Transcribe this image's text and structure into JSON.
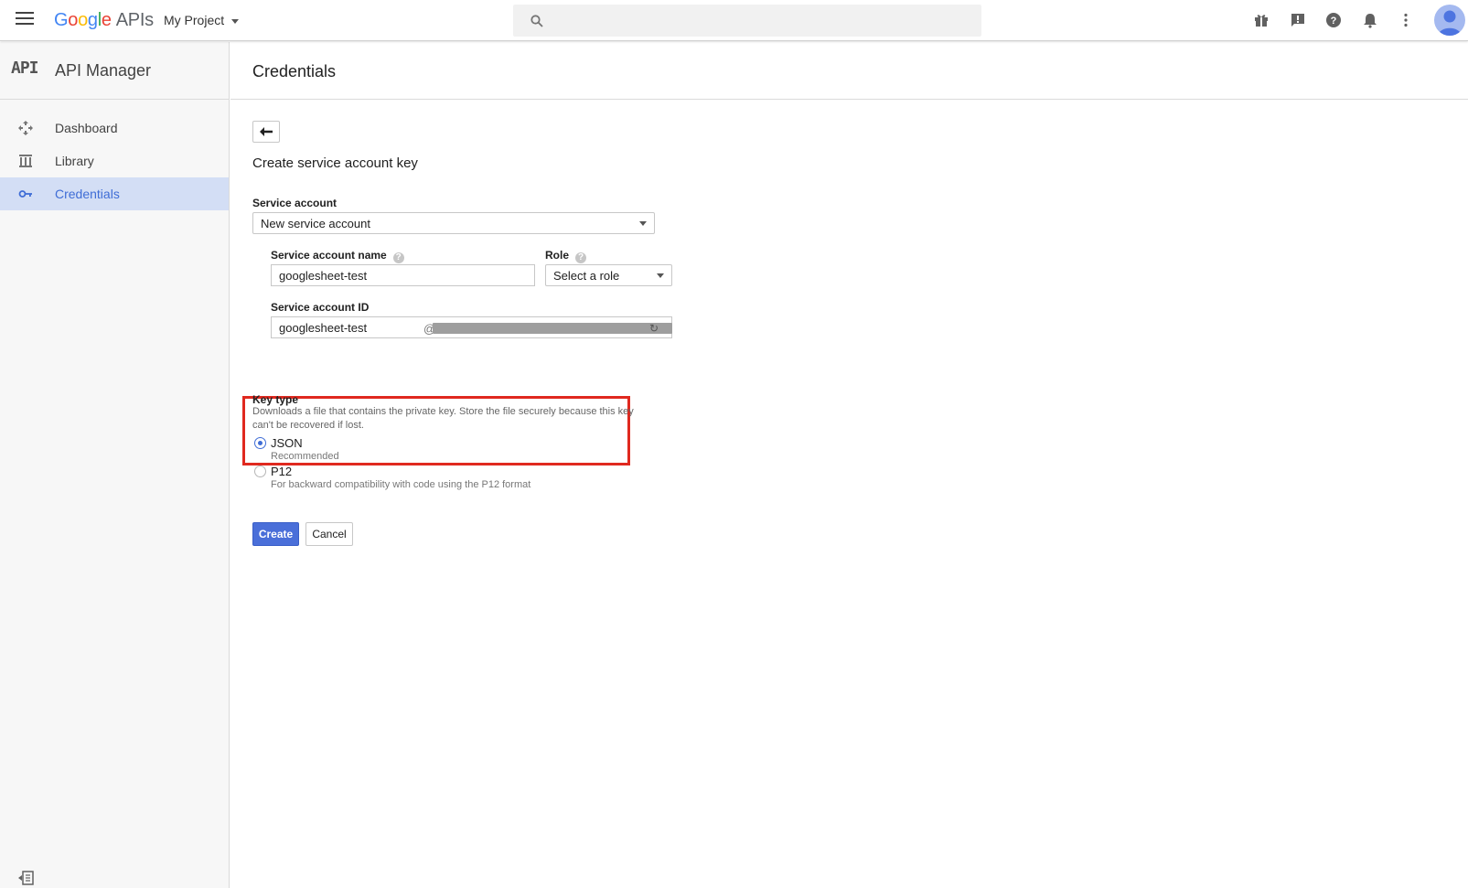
{
  "topbar": {
    "logo_letters": [
      "G",
      "o",
      "o",
      "g",
      "l",
      "e"
    ],
    "logo_suffix": "APIs",
    "project": "My Project",
    "search_placeholder": "",
    "icons": [
      "gift-icon",
      "feedback-icon",
      "help-icon",
      "notifications-icon",
      "more-vert-icon",
      "account-avatar"
    ]
  },
  "sidebar": {
    "mark": "API",
    "title": "API Manager",
    "items": [
      {
        "label": "Dashboard",
        "icon": "dashboard-icon",
        "active": false
      },
      {
        "label": "Library",
        "icon": "library-icon",
        "active": false
      },
      {
        "label": "Credentials",
        "icon": "key-icon",
        "active": true
      }
    ]
  },
  "page": {
    "title": "Credentials"
  },
  "form": {
    "title": "Create service account key",
    "service_account_label": "Service account",
    "service_account_value": "New service account",
    "name_label": "Service account name",
    "name_value": "googlesheet-test",
    "role_label": "Role",
    "role_value": "Select a role",
    "id_label": "Service account ID",
    "id_value": "googlesheet-test",
    "id_suffix_symbol": "@",
    "key_type_label": "Key type",
    "key_type_desc_1": "Downloads a file that contains the private key. Store the file securely because this key",
    "key_type_desc_2": "can't be recovered if lost.",
    "options": [
      {
        "label": "JSON",
        "sub": "Recommended",
        "selected": true
      },
      {
        "label": "P12",
        "sub": "For backward compatibility with code using the P12 format",
        "selected": false
      }
    ],
    "create_label": "Create",
    "cancel_label": "Cancel"
  },
  "colors": {
    "accent": "#4a6fd9",
    "active_nav_bg": "#d3def5",
    "highlight_box": "#e0291f"
  }
}
